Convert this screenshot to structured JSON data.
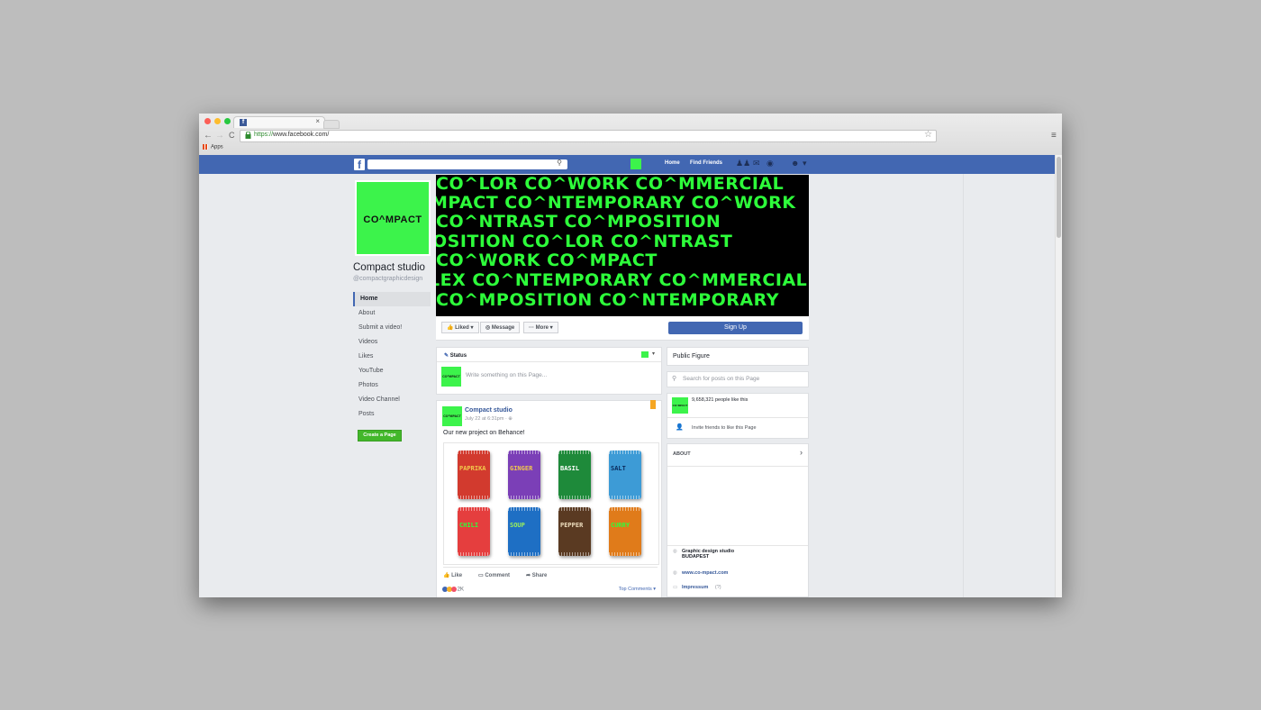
{
  "browser": {
    "tab_close": "×",
    "nav": {
      "back": "←",
      "forward": "→",
      "reload": "C"
    },
    "url_scheme": "https://",
    "url_rest": "www.facebook.com/",
    "bookmarks": {
      "apps_label": "Apps"
    },
    "star": "☆",
    "menu": "≡"
  },
  "fb_header": {
    "logo": "f",
    "search_icon": "⚲",
    "links": {
      "home": "Home",
      "find_friends": "Find Friends"
    },
    "icons": {
      "friends": "♟♟",
      "messages": "✉",
      "notifications": "◉",
      "account": "☻",
      "caret": "▾"
    }
  },
  "page": {
    "profile_text": "CO^MPACT",
    "name": "Compact studio",
    "handle": "@compactgraphicdesign",
    "nav": [
      {
        "label": "Home",
        "active": true
      },
      {
        "label": "About"
      },
      {
        "label": "Submit a video!"
      },
      {
        "label": "Videos"
      },
      {
        "label": "Likes"
      },
      {
        "label": "YouTube"
      },
      {
        "label": "Photos"
      },
      {
        "label": "Video Channel"
      },
      {
        "label": "Posts"
      }
    ],
    "create_page": "Create a Page"
  },
  "cover": {
    "lines": [
      "CO^LOR   CO^WORK   CO^MMERCIAL",
      "MPACT   CO^NTEMPORARY   CO^WORK",
      "   CO^NTRAST   CO^MPOSITION",
      "OSITION   CO^LOR   CO^NTRAST",
      "                CO^WORK   CO^MPACT",
      "LEX   CO^NTEMPORARY   CO^MMERCIAL",
      "CO^MPOSITION   CO^NTEMPORARY"
    ]
  },
  "actions": {
    "liked": "Liked ▾",
    "message": "Message",
    "more": "··· More ▾",
    "sign_up": "Sign Up"
  },
  "composer": {
    "title": "Status",
    "placeholder": "Write something on this Page...",
    "caret": "▾"
  },
  "post": {
    "author": "Compact studio",
    "date": "July 22 at 6:31pm · ⊕",
    "text": "Our new project on Behance!",
    "bag_labels": [
      "PAPRIKA",
      "GINGER",
      "BASIL",
      "SALT",
      "CHILI",
      "SOUP",
      "PEPPER",
      "CURRY"
    ],
    "like": "Like",
    "comment": "Comment",
    "share": "Share",
    "reactions_count": "2K",
    "top_comments": "Top Comments ▾"
  },
  "sidebar": {
    "category": "Public Figure",
    "search_placeholder": "Search for posts on this Page",
    "likes_text": "9,658,321 people like this",
    "invite_text": "Invite friends to like this Page",
    "about_header": "ABOUT",
    "about_rows": [
      {
        "icon": "◍",
        "line1": "Graphic design studio",
        "line2": "BUDAPEST"
      },
      {
        "icon": "◍",
        "line1": "www.co-mpact.com",
        "line2": ""
      },
      {
        "icon": "▭",
        "line1": "Impressum",
        "line2": "(?)"
      }
    ]
  },
  "colors": {
    "brand_green": "#3cf34b",
    "fb_blue": "#4267b2",
    "cover_bg": "#000000",
    "cover_text": "#2dff3a"
  }
}
